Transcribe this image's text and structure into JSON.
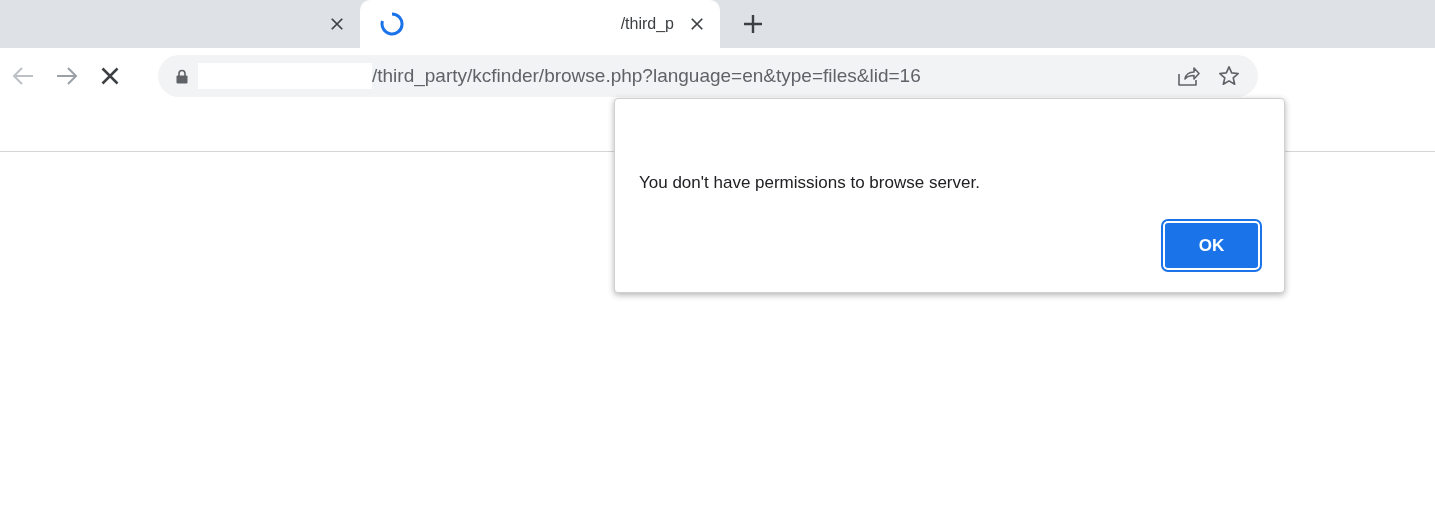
{
  "tabs": [
    {
      "selected": false,
      "loading": false
    },
    {
      "title": "/third_p",
      "selected": true,
      "loading": true
    }
  ],
  "address_bar": {
    "url": "/third_party/kcfinder/browse.php?language=en&type=files&lid=16"
  },
  "dialog": {
    "message": "You don't have permissions to browse server.",
    "buttons": [
      {
        "label": "OK",
        "focused": true
      }
    ]
  }
}
